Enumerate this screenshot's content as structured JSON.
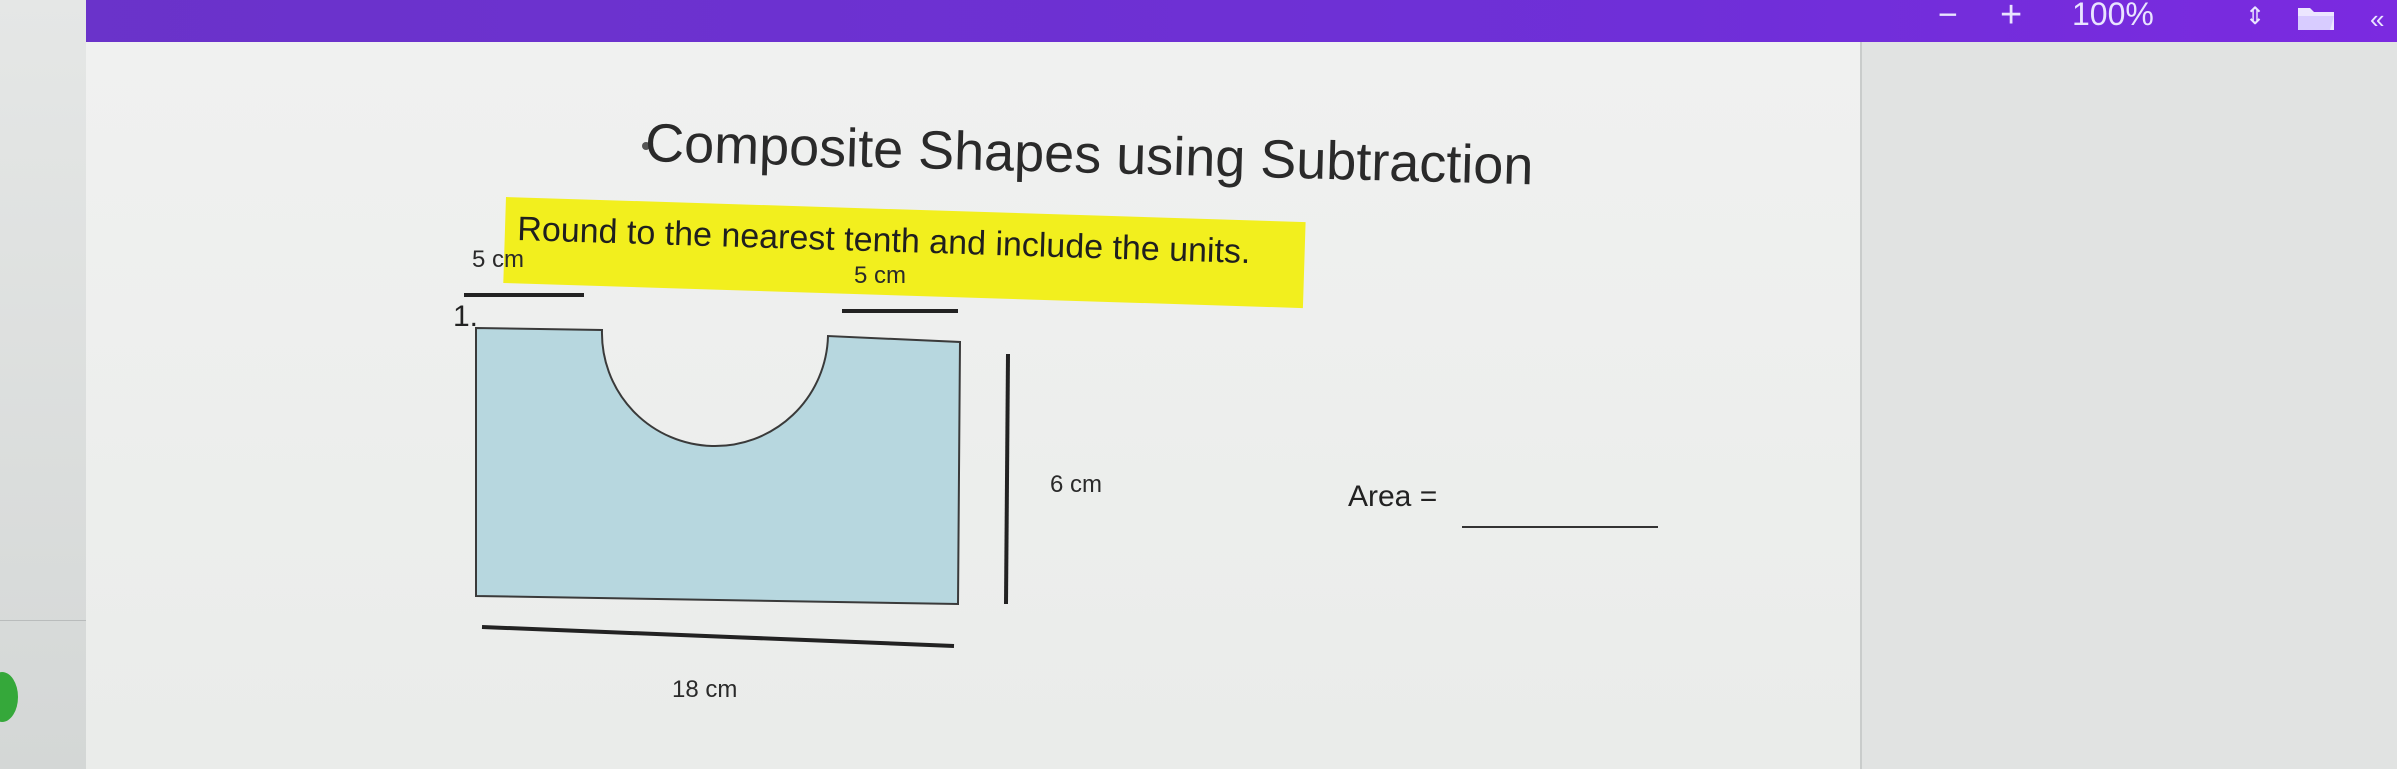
{
  "toolbar": {
    "zoom_minus": "−",
    "zoom_plus": "+",
    "zoom_level": "100%",
    "zoom_dropdown_glyph": "⇕",
    "folder_icon": "folder-icon",
    "more_glyph": "«"
  },
  "worksheet": {
    "title": "Composite Shapes using Subtraction",
    "instruction": "Round to the nearest tenth and include the units.",
    "problem_number": "1.",
    "dimensions": {
      "top_left": "5 cm",
      "top_right": "5 cm",
      "height": "6 cm",
      "base": "18 cm"
    },
    "area_label": "Area ="
  },
  "colors": {
    "toolbar": "#6f2fd8",
    "shape_fill": "#b7d7df",
    "highlight": "#f2ef1e"
  }
}
